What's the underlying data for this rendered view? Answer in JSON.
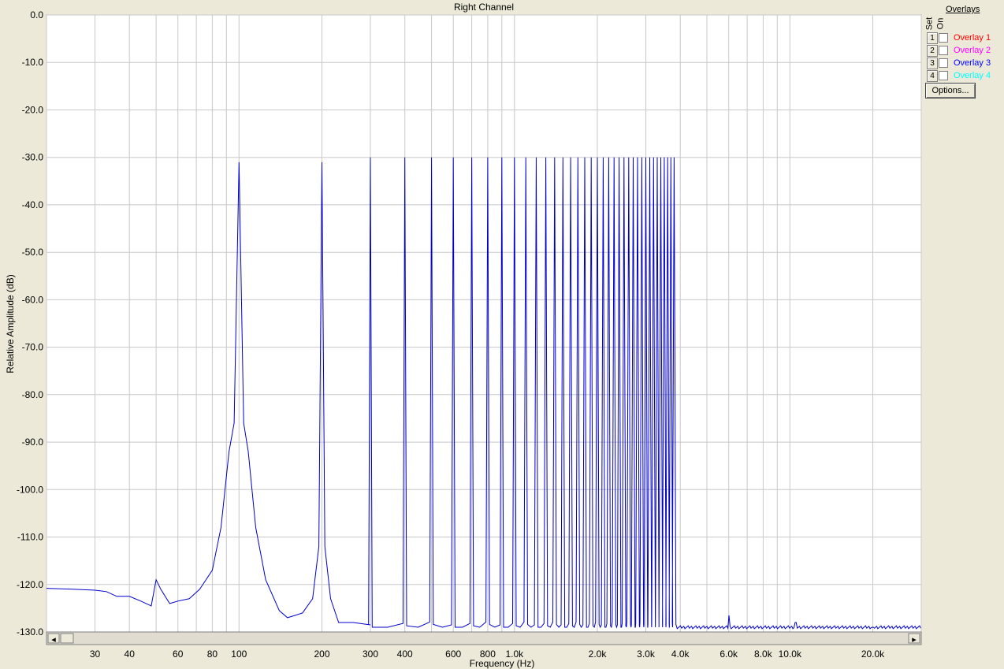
{
  "chart_data": {
    "type": "line",
    "title": "Right Channel",
    "xlabel": "Frequency (Hz)",
    "ylabel": "Relative Amplitude (dB)",
    "xscale": "log",
    "xlim": [
      20,
      30000
    ],
    "ylim": [
      -130,
      0
    ],
    "grid": true,
    "y_ticks": [
      0,
      -10,
      -20,
      -30,
      -40,
      -50,
      -60,
      -70,
      -80,
      -90,
      -100,
      -110,
      -120,
      -130
    ],
    "y_tick_labels": [
      "0.0",
      "-10.0",
      "-20.0",
      "-30.0",
      "-40.0",
      "-50.0",
      "-60.0",
      "-70.0",
      "-80.0",
      "-90.0",
      "-100.0",
      "-110.0",
      "-120.0",
      "-130.0"
    ],
    "x_ticks": [
      30,
      40,
      60,
      80,
      100,
      200,
      300,
      400,
      600,
      800,
      1000,
      2000,
      3000,
      4000,
      6000,
      8000,
      10000,
      20000
    ],
    "x_tick_labels": [
      "30",
      "40",
      "60",
      "80",
      "100",
      "200",
      "300",
      "400",
      "600",
      "800",
      "1.0k",
      "2.0k",
      "3.0k",
      "4.0k",
      "6.0k",
      "8.0k",
      "10.0k",
      "20.0k"
    ],
    "series": [
      {
        "color": "#0000cc",
        "x": [
          20,
          25,
          30,
          33,
          36,
          40,
          44,
          48,
          50,
          52,
          56,
          60,
          66,
          72,
          80,
          86,
          92,
          96,
          100,
          104,
          108,
          115,
          125,
          140,
          150,
          160,
          170,
          185,
          195,
          200,
          205,
          215,
          230,
          260,
          300
        ],
        "y": [
          -120.8,
          -121,
          -121.2,
          -121.5,
          -122.5,
          -122.5,
          -123.5,
          -124.5,
          -119,
          -121,
          -124,
          -123.5,
          -123,
          -121,
          -117,
          -108,
          -92,
          -86,
          -31,
          -86,
          -92,
          -108,
          -119,
          -125.5,
          -127,
          -126.5,
          -126,
          -123,
          -112,
          -31,
          -112,
          -123,
          -128,
          -128,
          -128.5
        ],
        "peaks_x": [
          300,
          400,
          500,
          600,
          700,
          800,
          900,
          1000,
          1100,
          1200,
          1300,
          1400,
          1500,
          1600,
          1700,
          1800,
          1900,
          2000,
          2100,
          2200,
          2300,
          2400,
          2500,
          2600,
          2700,
          2800,
          2900,
          3000,
          3100,
          3200,
          3300,
          3400,
          3500,
          3600,
          3700,
          3800
        ],
        "peaks_y": -30,
        "noise_floor": [
          [
            4000,
            -129
          ],
          [
            6000,
            -129
          ],
          [
            10000,
            -129
          ],
          [
            20000,
            -129
          ],
          [
            30000,
            -129
          ]
        ],
        "floor_spikes": [
          [
            6000,
            -126.5
          ],
          [
            10500,
            -128
          ],
          [
            20000,
            -129
          ]
        ]
      }
    ]
  },
  "overlays_panel": {
    "header_set": "Set",
    "header_on": "On",
    "header_overlays": "Overlays",
    "items": [
      {
        "set_label": "1",
        "label": "Overlay 1",
        "color": "#ff0000"
      },
      {
        "set_label": "2",
        "label": "Overlay 2",
        "color": "#ff00ff"
      },
      {
        "set_label": "3",
        "label": "Overlay 3",
        "color": "#0000ff"
      },
      {
        "set_label": "4",
        "label": "Overlay 4",
        "color": "#00ffff"
      }
    ],
    "options_label": "Options..."
  },
  "scrollbar": {
    "left_arrow": "◂",
    "right_arrow": "▸"
  }
}
